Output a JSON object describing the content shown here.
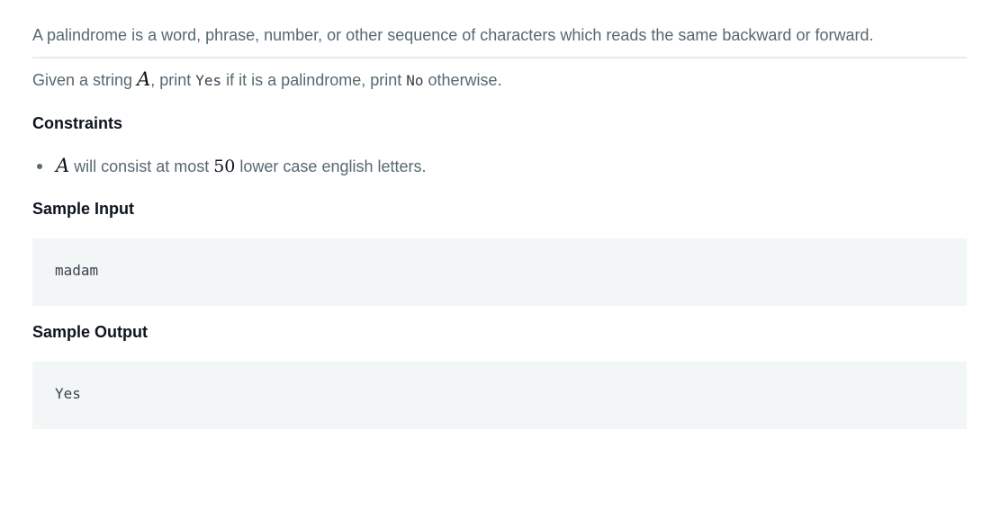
{
  "problem": {
    "intro": "A palindrome is a word, phrase, number, or other sequence of characters which reads the same backward or forward.",
    "task": {
      "prefix": "Given a string ",
      "var": "A",
      "mid1": ", print ",
      "yes": "Yes",
      "mid2": " if it is a palindrome, print ",
      "no": "No",
      "suffix": " otherwise."
    },
    "constraints_heading": "Constraints",
    "constraints": [
      {
        "var": "A",
        "text1": " will consist at most ",
        "num": "50",
        "text2": " lower case english letters."
      }
    ],
    "sample_input_heading": "Sample Input",
    "sample_input": "madam",
    "sample_output_heading": "Sample Output",
    "sample_output": "Yes"
  }
}
